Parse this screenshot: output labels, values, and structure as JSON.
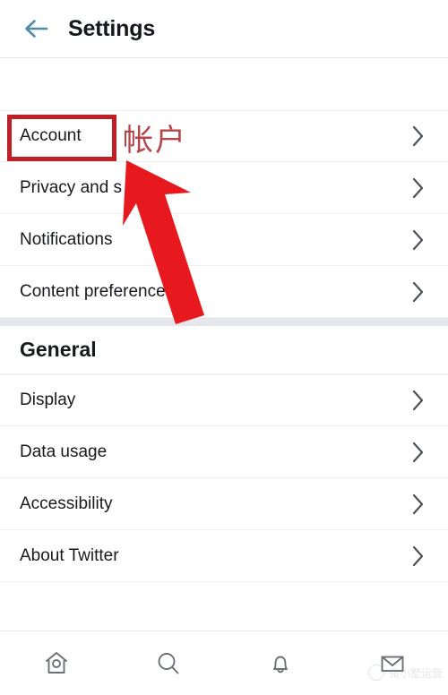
{
  "header": {
    "title": "Settings",
    "back_icon": "arrow-left-icon",
    "back_icon_color": "#4f8fa6"
  },
  "account_section": {
    "rows": [
      {
        "label": "Account",
        "chevron": "chevron-right-icon"
      },
      {
        "label": "Privacy and s",
        "chevron": "chevron-right-icon"
      },
      {
        "label": "Notifications",
        "chevron": "chevron-right-icon"
      },
      {
        "label": "Content preferences",
        "chevron": "chevron-right-icon"
      }
    ]
  },
  "general_section": {
    "title": "General",
    "rows": [
      {
        "label": "Display",
        "chevron": "chevron-right-icon"
      },
      {
        "label": "Data usage",
        "chevron": "chevron-right-icon"
      },
      {
        "label": "Accessibility",
        "chevron": "chevron-right-icon"
      },
      {
        "label": "About Twitter",
        "chevron": "chevron-right-icon"
      }
    ]
  },
  "bottom_nav": {
    "items": [
      {
        "icon": "home-icon",
        "label": "Home"
      },
      {
        "icon": "search-icon",
        "label": "Search"
      },
      {
        "icon": "bell-icon",
        "label": "Notifications"
      },
      {
        "icon": "mail-icon",
        "label": "Messages"
      }
    ]
  },
  "annotation": {
    "highlight_target": "Account",
    "highlight_color": "#bf2026",
    "arrow_color": "#e8191e",
    "arrow_icon": "red-arrow-annotation",
    "chinese_note": "帐户"
  },
  "watermark": {
    "text": "微小墅运营",
    "icon": "wechat-logo-icon"
  }
}
